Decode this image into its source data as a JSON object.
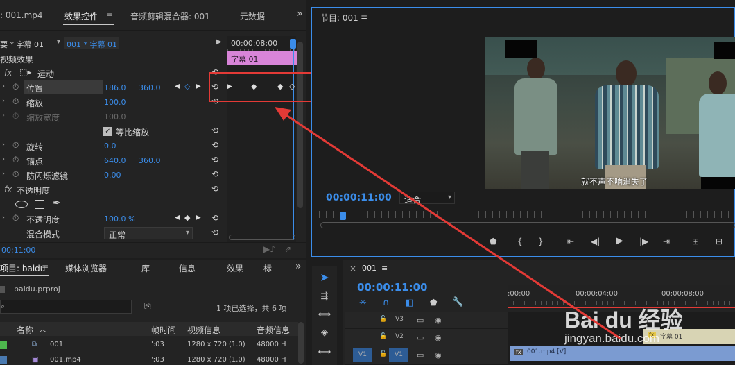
{
  "effects_panel": {
    "tab_left": ": 001.mp4",
    "tab_active": "效果控件",
    "tab_active_menu": "≡",
    "tab_audio": "音频剪辑混合器: 001",
    "tab_meta": "元数据",
    "overflow": "»",
    "master_clip": "要 * 字幕 01",
    "sequence_clip": "001 * 字幕 01",
    "timecode_ruler": "00:00:08:00",
    "clip_bar_label": "字幕 01",
    "video_effects": "视频效果",
    "motion": "运动",
    "position_label": "位置",
    "position_x": "186.0",
    "position_y": "360.0",
    "scale_label": "缩放",
    "scale_value": "100.0",
    "scale_width_label": "缩放宽度",
    "scale_width_value": "100.0",
    "uniform_scale": "等比缩放",
    "rotation_label": "旋转",
    "rotation_value": "0.0",
    "anchor_label": "锚点",
    "anchor_x": "640.0",
    "anchor_y": "360.0",
    "flicker_label": "防闪烁滤镜",
    "flicker_value": "0.00",
    "opacity_section": "不透明度",
    "opacity_label": "不透明度",
    "opacity_value": "100.0 %",
    "blend_label": "混合模式",
    "blend_value": "正常",
    "bottom_timecode": "00:11:00"
  },
  "program_monitor": {
    "title": "节目: 001",
    "menu": "≡",
    "subtitle": "就不声不响消失了",
    "timecode": "00:00:11:00",
    "fit_value": "适合"
  },
  "project_panel": {
    "tab_project": "项目: baidu",
    "tab_media": "媒体浏览器",
    "tab_library": "库",
    "tab_info": "信息",
    "tab_effects": "效果",
    "tab_marker": "标",
    "overflow": "»",
    "file": "baidu.prproj",
    "selection": "1 项已选择，共 6 项",
    "col_name": "名称",
    "col_rate": "帧时间",
    "col_video": "视频信息",
    "col_audio": "音频信息",
    "rows": [
      {
        "name": "001",
        "rate": "':03",
        "video": "1280 x 720 (1.0)",
        "audio": "48000 H"
      },
      {
        "name": "001.mp4",
        "rate": "':03",
        "video": "1280 x 720 (1.0)",
        "audio": "48000 H"
      }
    ]
  },
  "timeline": {
    "close": "×",
    "title": "001",
    "menu": "≡",
    "timecode": "00:00:11:00",
    "ruler": [
      ":00:00",
      "00:00:04:00",
      "00:00:08:00"
    ],
    "tracks": [
      "V3",
      "V2",
      "V1"
    ],
    "source_patch": "V1",
    "subtitle_clip": "字幕 01",
    "video_clip": "001.mp4 [V]"
  },
  "watermark": {
    "brand": "Bai du 经验",
    "url": "jingyan.baidu.com"
  },
  "colors": {
    "accent_blue": "#3b8dea",
    "annotation_red": "#e33a36",
    "clip_pink": "#d884d8",
    "clip_blue": "#7b9bd1"
  }
}
